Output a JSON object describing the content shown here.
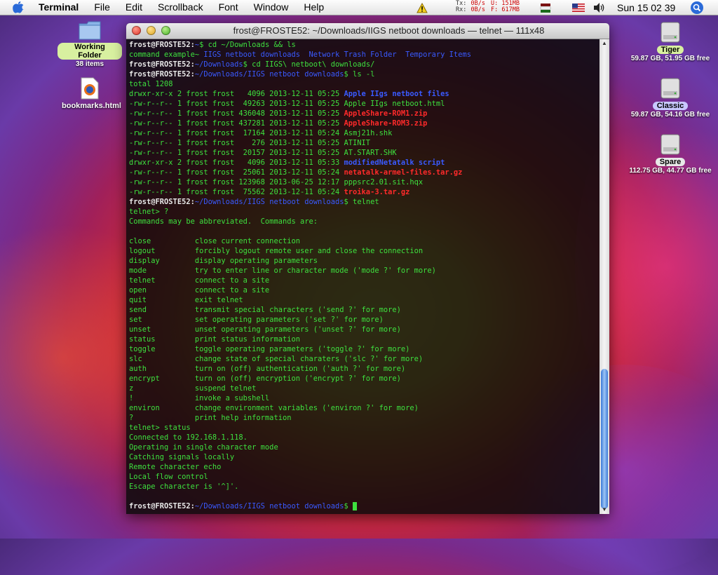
{
  "menubar": {
    "app": "Terminal",
    "items": [
      "File",
      "Edit",
      "Scrollback",
      "Font",
      "Window",
      "Help"
    ],
    "net": {
      "tx_label": "Tx:",
      "tx_val": "0B/s",
      "rx_label": "Rx:",
      "rx_val": "0B/s",
      "used": "U: 151MB",
      "free": "F: 617MB"
    },
    "clock": "Sun 15 02 39"
  },
  "desktop": {
    "left_icons": [
      {
        "name": "Working Folder",
        "sub": "38 items"
      },
      {
        "name": "bookmarks.html",
        "sub": ""
      }
    ],
    "drives": [
      {
        "name": "Tiger",
        "info": "59.87 GB, 51.95 GB free",
        "tag_color": "#d8f0a0"
      },
      {
        "name": "Classic",
        "info": "59.87 GB, 54.16 GB free",
        "tag_color": "#c8c8ff"
      },
      {
        "name": "Spare",
        "info": "112.75 GB, 44.77 GB free",
        "tag_color": "#e8e8e8"
      }
    ]
  },
  "window": {
    "title": "frost@FROSTE52: ~/Downloads/IIGS netboot downloads — telnet — 111x48"
  },
  "terminal": {
    "user": "frost@FROSTE52:",
    "lines": [
      {
        "t": "cmd",
        "path": "~",
        "cmd": "$ cd ~/Downloads && ls"
      },
      {
        "t": "mixed",
        "parts": [
          [
            "g",
            "command example~ "
          ],
          [
            "p",
            "IIGS netboot downloads  Network Trash Folder  Temporary Items"
          ]
        ]
      },
      {
        "t": "cmd",
        "path": "~/Downloads",
        "cmd": "$ cd IIGS\\ netboot\\ downloads/"
      },
      {
        "t": "cmd",
        "path": "~/Downloads/IIGS netboot downloads",
        "cmd": "$ ls -l"
      },
      {
        "t": "plain",
        "text": "total 1208"
      },
      {
        "t": "ls",
        "meta": "drwxr-xr-x 2 frost frost   4096 2013-12-11 05:25 ",
        "name": "Apple IIgs netboot files",
        "cls": "dir"
      },
      {
        "t": "ls",
        "meta": "-rw-r--r-- 1 frost frost  49263 2013-12-11 05:25 ",
        "name": "Apple IIgs netboot.html",
        "cls": "g"
      },
      {
        "t": "ls",
        "meta": "-rw-r--r-- 1 frost frost 436048 2013-12-11 05:25 ",
        "name": "AppleShare-ROM1.zip",
        "cls": "red"
      },
      {
        "t": "ls",
        "meta": "-rw-r--r-- 1 frost frost 437281 2013-12-11 05:25 ",
        "name": "AppleShare-ROM3.zip",
        "cls": "red"
      },
      {
        "t": "ls",
        "meta": "-rw-r--r-- 1 frost frost  17164 2013-12-11 05:24 ",
        "name": "Asmj21h.shk",
        "cls": "g"
      },
      {
        "t": "ls",
        "meta": "-rw-r--r-- 1 frost frost    276 2013-12-11 05:25 ",
        "name": "ATINIT",
        "cls": "g"
      },
      {
        "t": "ls",
        "meta": "-rw-r--r-- 1 frost frost  20157 2013-12-11 05:25 ",
        "name": "AT.START.SHK",
        "cls": "g"
      },
      {
        "t": "ls",
        "meta": "drwxr-xr-x 2 frost frost   4096 2013-12-11 05:33 ",
        "name": "modifiedNetatalk script",
        "cls": "dir"
      },
      {
        "t": "ls",
        "meta": "-rw-r--r-- 1 frost frost  25061 2013-12-11 05:24 ",
        "name": "netatalk-armel-files.tar.gz",
        "cls": "red"
      },
      {
        "t": "ls",
        "meta": "-rw-r--r-- 1 frost frost 123968 2013-06-25 12:17 ",
        "name": "pppsrc2.01.sit.hqx",
        "cls": "g"
      },
      {
        "t": "ls",
        "meta": "-rw-r--r-- 1 frost frost  75562 2013-12-11 05:24 ",
        "name": "troika-3.tar.gz",
        "cls": "red"
      },
      {
        "t": "cmd",
        "path": "~/Downloads/IIGS netboot downloads",
        "cmd": "$ telnet"
      },
      {
        "t": "plain",
        "text": "telnet> ?"
      },
      {
        "t": "plain",
        "text": "Commands may be abbreviated.  Commands are:"
      },
      {
        "t": "plain",
        "text": ""
      },
      {
        "t": "plain",
        "text": "close          close current connection"
      },
      {
        "t": "plain",
        "text": "logout         forcibly logout remote user and close the connection"
      },
      {
        "t": "plain",
        "text": "display        display operating parameters"
      },
      {
        "t": "plain",
        "text": "mode           try to enter line or character mode ('mode ?' for more)"
      },
      {
        "t": "plain",
        "text": "telnet         connect to a site"
      },
      {
        "t": "plain",
        "text": "open           connect to a site"
      },
      {
        "t": "plain",
        "text": "quit           exit telnet"
      },
      {
        "t": "plain",
        "text": "send           transmit special characters ('send ?' for more)"
      },
      {
        "t": "plain",
        "text": "set            set operating parameters ('set ?' for more)"
      },
      {
        "t": "plain",
        "text": "unset          unset operating parameters ('unset ?' for more)"
      },
      {
        "t": "plain",
        "text": "status         print status information"
      },
      {
        "t": "plain",
        "text": "toggle         toggle operating parameters ('toggle ?' for more)"
      },
      {
        "t": "plain",
        "text": "slc            change state of special charaters ('slc ?' for more)"
      },
      {
        "t": "plain",
        "text": "auth           turn on (off) authentication ('auth ?' for more)"
      },
      {
        "t": "plain",
        "text": "encrypt        turn on (off) encryption ('encrypt ?' for more)"
      },
      {
        "t": "plain",
        "text": "z              suspend telnet"
      },
      {
        "t": "plain",
        "text": "!              invoke a subshell"
      },
      {
        "t": "plain",
        "text": "environ        change environment variables ('environ ?' for more)"
      },
      {
        "t": "plain",
        "text": "?              print help information"
      },
      {
        "t": "plain",
        "text": "telnet> status"
      },
      {
        "t": "plain",
        "text": "Connected to 192.168.1.118."
      },
      {
        "t": "plain",
        "text": "Operating in single character mode"
      },
      {
        "t": "plain",
        "text": "Catching signals locally"
      },
      {
        "t": "plain",
        "text": "Remote character echo"
      },
      {
        "t": "plain",
        "text": "Local flow control"
      },
      {
        "t": "plain",
        "text": "Escape character is '^]'."
      },
      {
        "t": "plain",
        "text": ""
      },
      {
        "t": "cmd",
        "path": "~/Downloads/IIGS netboot downloads",
        "cmd": "$ ",
        "cursor": true
      }
    ]
  }
}
